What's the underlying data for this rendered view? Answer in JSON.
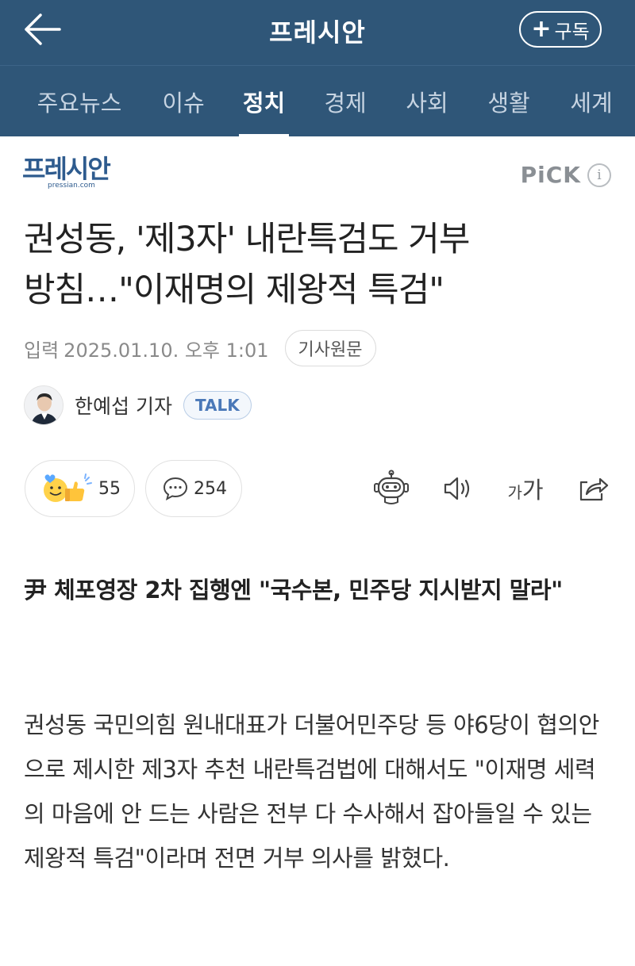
{
  "header": {
    "title": "프레시안",
    "subscribe_label": "구독",
    "subscribe_plus": "+"
  },
  "tabs": [
    {
      "label": "주요뉴스",
      "active": false
    },
    {
      "label": "이슈",
      "active": false
    },
    {
      "label": "정치",
      "active": true
    },
    {
      "label": "경제",
      "active": false
    },
    {
      "label": "사회",
      "active": false
    },
    {
      "label": "생활",
      "active": false
    },
    {
      "label": "세계",
      "active": false
    }
  ],
  "press": {
    "logo_text": "프레시안",
    "logo_domain": "pressian.com",
    "pick_label": "PiCK",
    "info_glyph": "i"
  },
  "article": {
    "headline_line1": "권성동, '제3자' 내란특검도 거부",
    "headline_line2": "방침…\"이재명의 제왕적 특검\"",
    "date_label": "입력",
    "date_value": "2025.01.10. 오후 1:01",
    "original_link": "기사원문",
    "reporter": "한예섭 기자",
    "talk_label": "TALK",
    "reaction_count": "55",
    "comment_count": "254",
    "fontsize_small": "가",
    "fontsize_big": "가",
    "subtitle": "尹 체포영장 2차 집행엔 \"국수본, 민주당 지시받지 말라\"",
    "body": "권성동 국민의힘 원내대표가 더불어민주당 등 야6당이 협의안으로 제시한 제3자 추천 내란특검법에 대해서도 \"이재명 세력의 마음에 안 드는 사람은 전부 다 수사해서 잡아들일 수 있는 제왕적 특검\"이라며 전면 거부 의사를 밝혔다."
  },
  "colors": {
    "header_bg": "#2f5678",
    "brand_blue": "#2e5b8e",
    "talk_blue": "#4a78b8"
  },
  "icons": [
    "back-arrow-icon",
    "plus-icon",
    "info-icon",
    "reaction-emoji-icon",
    "comment-bubble-icon",
    "robot-summary-icon",
    "speaker-icon",
    "font-size-icon",
    "share-icon"
  ]
}
